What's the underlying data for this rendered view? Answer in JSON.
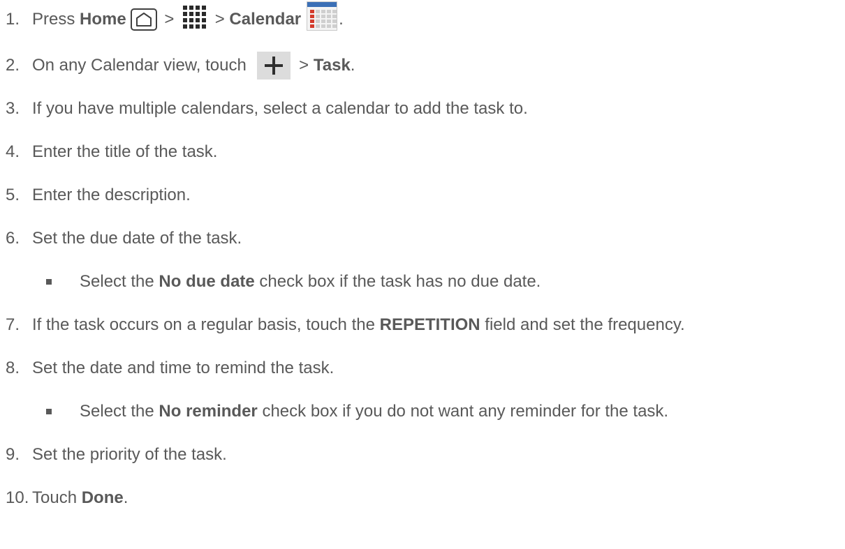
{
  "steps": [
    {
      "num": "1.",
      "parts": [
        "Press ",
        "Home",
        " > ",
        " > ",
        "Calendar",
        "."
      ]
    },
    {
      "num": "2.",
      "parts": [
        "On any Calendar view, touch ",
        " > ",
        "Task",
        "."
      ]
    },
    {
      "num": "3.",
      "text": "If you have multiple calendars, select a calendar to add the task to."
    },
    {
      "num": "4.",
      "text": "Enter the title of the task."
    },
    {
      "num": "5.",
      "text": "Enter the description."
    },
    {
      "num": "6.",
      "text": "Set the due date of the task."
    },
    {
      "sub": true,
      "parts": [
        "Select the ",
        "No due date",
        " check box if the task has no due date."
      ]
    },
    {
      "num": "7.",
      "parts": [
        "If the task occurs on a regular basis, touch the ",
        "REPETITION",
        " field and set the frequency."
      ]
    },
    {
      "num": "8.",
      "text": "Set the date and time to remind the task."
    },
    {
      "sub": true,
      "parts": [
        "Select the ",
        "No reminder",
        " check box if you do not want any reminder for the task."
      ]
    },
    {
      "num": "9.",
      "text": "Set the priority of the task."
    },
    {
      "num": "10.",
      "parts": [
        "Touch ",
        "Done",
        "."
      ]
    }
  ],
  "icons": {
    "home": "home-icon",
    "apps": "apps-grid-icon",
    "calendar": "calendar-app-icon",
    "add": "plus-icon",
    "bullet": "square-bullet-icon"
  }
}
